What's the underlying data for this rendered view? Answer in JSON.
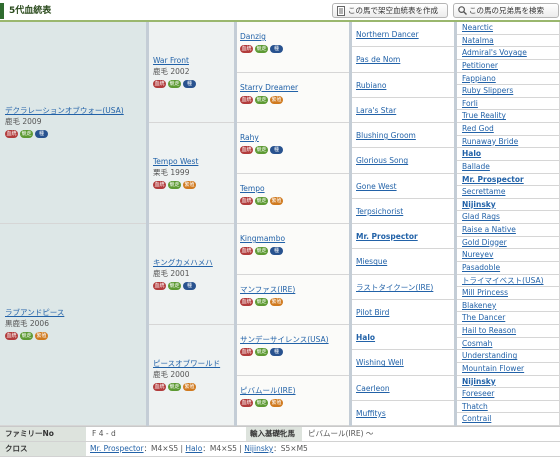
{
  "header": {
    "title": "5代血統表",
    "create_button": "この馬で架空血統表を作成",
    "search_button": "この馬の兄弟馬を検索"
  },
  "badge_labels": {
    "red": "血統",
    "green": "競走",
    "blue": "種",
    "orange": "繁殖"
  },
  "colors": {
    "accent_green": "#2f6b2f",
    "link_blue": "#2262a8",
    "badge_red": "#b23c3c",
    "badge_green": "#5d9a33",
    "badge_blue": "#28528f",
    "badge_orange": "#d07a1f"
  },
  "gen1": [
    {
      "name": "デクラレーションオブウォー(USA)",
      "info": "鹿毛 2009"
    },
    {
      "name": "ラブアンドピース",
      "info": "黒鹿毛 2006"
    }
  ],
  "gen2": [
    {
      "name": "War Front",
      "info": "鹿毛 2002"
    },
    {
      "name": "Tempo West",
      "info": "栗毛 1999"
    },
    {
      "name": "キングカメハメハ",
      "info": "鹿毛 2001"
    },
    {
      "name": "ピースオブワールド",
      "info": "鹿毛 2000"
    }
  ],
  "gen3": [
    {
      "name": "Danzig"
    },
    {
      "name": "Starry Dreamer"
    },
    {
      "name": "Rahy"
    },
    {
      "name": "Tempo"
    },
    {
      "name": "Kingmambo"
    },
    {
      "name": "マンファス(IRE)"
    },
    {
      "name": "サンデーサイレンス(USA)"
    },
    {
      "name": "ピバムール(IRE)"
    }
  ],
  "gen4": [
    "Northern Dancer",
    "Pas de Nom",
    "Rubiano",
    "Lara's Star",
    "Blushing Groom",
    "Glorious Song",
    "Gone West",
    "Terpsichorist",
    "Mr. Prospector",
    "Miesque",
    "ラストタイクーン(IRE)",
    "Pilot Bird",
    "Halo",
    "Wishing Well",
    "Caerleon",
    "Muffitys"
  ],
  "gen5": [
    "Nearctic",
    "Natalma",
    "Admiral's Voyage",
    "Petitioner",
    "Fappiano",
    "Ruby Slippers",
    "Forli",
    "True Reality",
    "Red God",
    "Runaway Bride",
    "Halo",
    "Ballade",
    "Mr. Prospector",
    "Secrettame",
    "Nijinsky",
    "Glad Rags",
    "Raise a Native",
    "Gold Digger",
    "Nureyev",
    "Pasadoble",
    "トライマイベスト(USA)",
    "Mill Princess",
    "Blakeney",
    "The Dancer",
    "Hail to Reason",
    "Cosmah",
    "Understanding",
    "Mountain Flower",
    "Nijinsky",
    "Foreseer",
    "Thatch",
    "Contrail"
  ],
  "footer": {
    "family_label": "ファミリーNo",
    "family_value": "F 4 - d",
    "import_label": "輸入基礎牝馬",
    "import_value": "ピバムール(IRE) ～",
    "cross_label": "クロス",
    "crosses": [
      {
        "name": "Mr. Prospector",
        "detail": "：M4×S5"
      },
      {
        "name": "Halo",
        "detail": "：M4×S5"
      },
      {
        "name": "Nijinsky",
        "detail": "：S5×M5"
      }
    ]
  }
}
